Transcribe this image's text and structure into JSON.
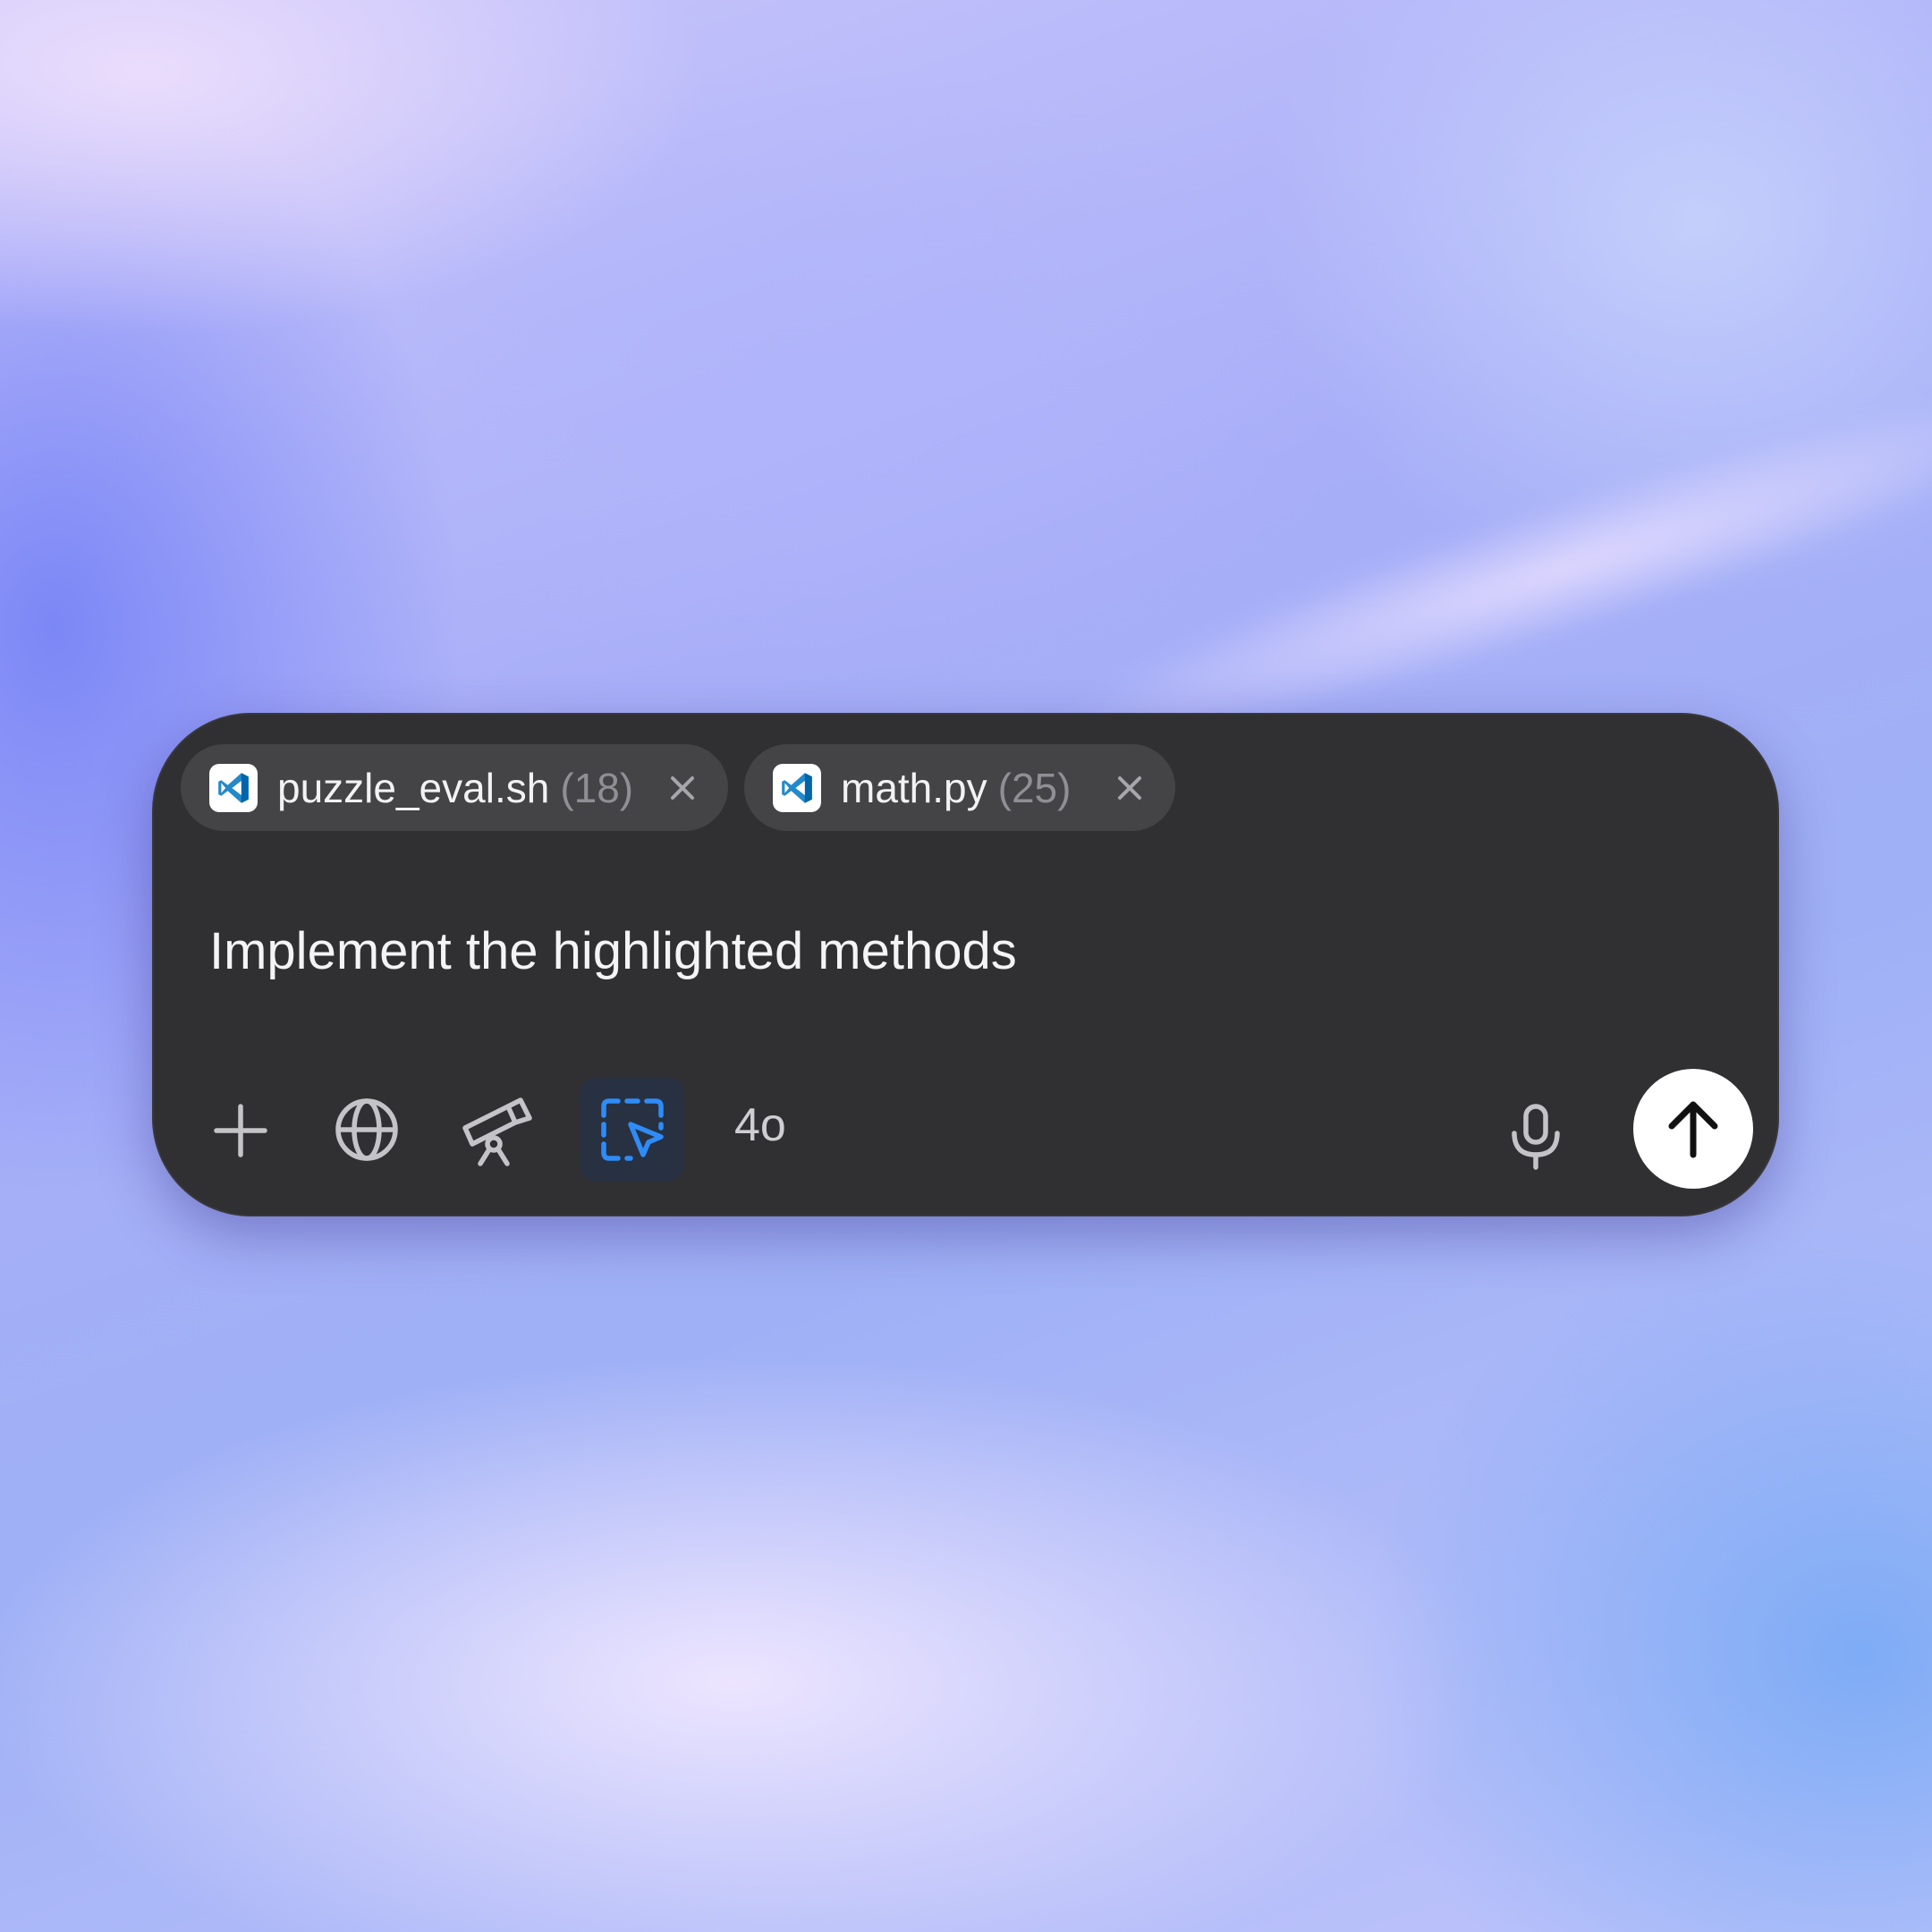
{
  "attachments": [
    {
      "name": "puzzle_eval.sh",
      "count": "(18)",
      "icon": "vscode-icon"
    },
    {
      "name": "math.py",
      "count": "(25)",
      "icon": "vscode-icon"
    }
  ],
  "prompt": {
    "text": "Implement the highlighted methods"
  },
  "toolbar": {
    "model_label": "4o",
    "icons": [
      "plus-icon",
      "globe-icon",
      "telescope-icon",
      "screen-select-icon",
      "microphone-icon",
      "arrow-up-icon"
    ]
  },
  "colors": {
    "panel": "#303033",
    "chip": "#444447",
    "accent": "#2f8cf6",
    "active_tool_bg": "#273142",
    "send_bg": "#ffffff"
  }
}
